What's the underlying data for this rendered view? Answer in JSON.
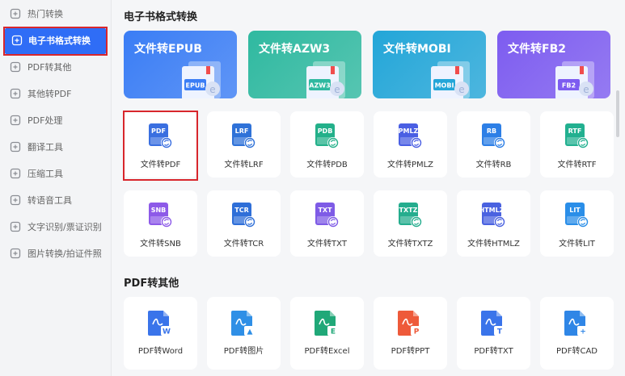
{
  "sidebar": {
    "items": [
      {
        "label": "热门转换",
        "icon": "hot-icon"
      },
      {
        "label": "电子书格式转换",
        "icon": "ebook-convert-icon",
        "active": true
      },
      {
        "label": "PDF转其他",
        "icon": "pdf-convert-icon"
      },
      {
        "label": "其他转PDF",
        "icon": "to-pdf-icon"
      },
      {
        "label": "PDF处理",
        "icon": "pdf-process-icon"
      },
      {
        "label": "翻译工具",
        "icon": "translate-icon"
      },
      {
        "label": "压缩工具",
        "icon": "compress-icon"
      },
      {
        "label": "转语音工具",
        "icon": "voice-icon"
      },
      {
        "label": "文字识别/票证识别",
        "icon": "ocr-icon"
      },
      {
        "label": "图片转换/拍证件照",
        "icon": "image-convert-icon"
      }
    ]
  },
  "sections": {
    "ebook_title": "电子书格式转换",
    "pdf_other_title": "PDF转其他"
  },
  "banners": [
    {
      "title": "文件转EPUB",
      "tag": "EPUB",
      "color": "#3a7df5"
    },
    {
      "title": "文件转AZW3",
      "tag": "AZW3",
      "color": "#2fb9a0"
    },
    {
      "title": "文件转MOBI",
      "tag": "MOBI",
      "color": "#23a6d8"
    },
    {
      "title": "文件转FB2",
      "tag": "FB2",
      "color": "#7d5cf0"
    }
  ],
  "ebook_tools": [
    {
      "label": "文件转PDF",
      "tag": "PDF",
      "color": "#3a6fe0"
    },
    {
      "label": "文件转LRF",
      "tag": "LRF",
      "color": "#2f72d8"
    },
    {
      "label": "文件转PDB",
      "tag": "PDB",
      "color": "#23b08a"
    },
    {
      "label": "文件转PMLZ",
      "tag": "PMLZ",
      "color": "#4a5fe3"
    },
    {
      "label": "文件转RB",
      "tag": "RB",
      "color": "#2d7fe6"
    },
    {
      "label": "文件转RTF",
      "tag": "RTF",
      "color": "#22b090"
    },
    {
      "label": "文件转SNB",
      "tag": "SNB",
      "color": "#8d5ae8"
    },
    {
      "label": "文件转TCR",
      "tag": "TCR",
      "color": "#2f6fd8"
    },
    {
      "label": "文件转TXT",
      "tag": "TXT",
      "color": "#7e5be6"
    },
    {
      "label": "文件转TXTZ",
      "tag": "TXTZ",
      "color": "#25ad8e"
    },
    {
      "label": "文件转HTMLZ",
      "tag": "HTMLZ",
      "color": "#4a62e0"
    },
    {
      "label": "文件转LIT",
      "tag": "LIT",
      "color": "#2a8ee8"
    }
  ],
  "pdf_tools": [
    {
      "label": "PDF转Word",
      "badge": "W",
      "color": "#3a74ea"
    },
    {
      "label": "PDF转图片",
      "badge": "▲",
      "color": "#2f8fe6"
    },
    {
      "label": "PDF转Excel",
      "badge": "E",
      "color": "#20a878"
    },
    {
      "label": "PDF转PPT",
      "badge": "P",
      "color": "#ee5a3a"
    },
    {
      "label": "PDF转TXT",
      "badge": "T",
      "color": "#3a74ea"
    },
    {
      "label": "PDF转CAD",
      "badge": "+",
      "color": "#2f86e6"
    }
  ]
}
